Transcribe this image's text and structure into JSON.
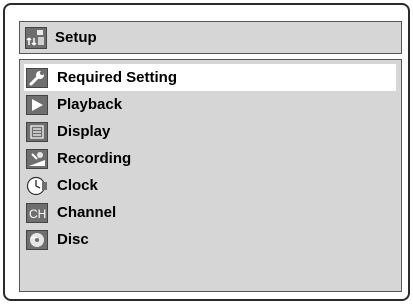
{
  "header": {
    "title": "Setup",
    "icon": "setup-icon"
  },
  "menu": {
    "selected_index": 0,
    "items": [
      {
        "label": "Required Setting",
        "icon": "wrench-icon"
      },
      {
        "label": "Playback",
        "icon": "play-icon"
      },
      {
        "label": "Display",
        "icon": "display-icon"
      },
      {
        "label": "Recording",
        "icon": "recording-icon"
      },
      {
        "label": "Clock",
        "icon": "clock-icon"
      },
      {
        "label": "Channel",
        "icon": "channel-icon"
      },
      {
        "label": "Disc",
        "icon": "disc-icon"
      }
    ]
  },
  "colors": {
    "panel_bg": "#d6d6d6",
    "selected_bg": "#ffffff",
    "icon_bg": "#6f6f6f"
  }
}
